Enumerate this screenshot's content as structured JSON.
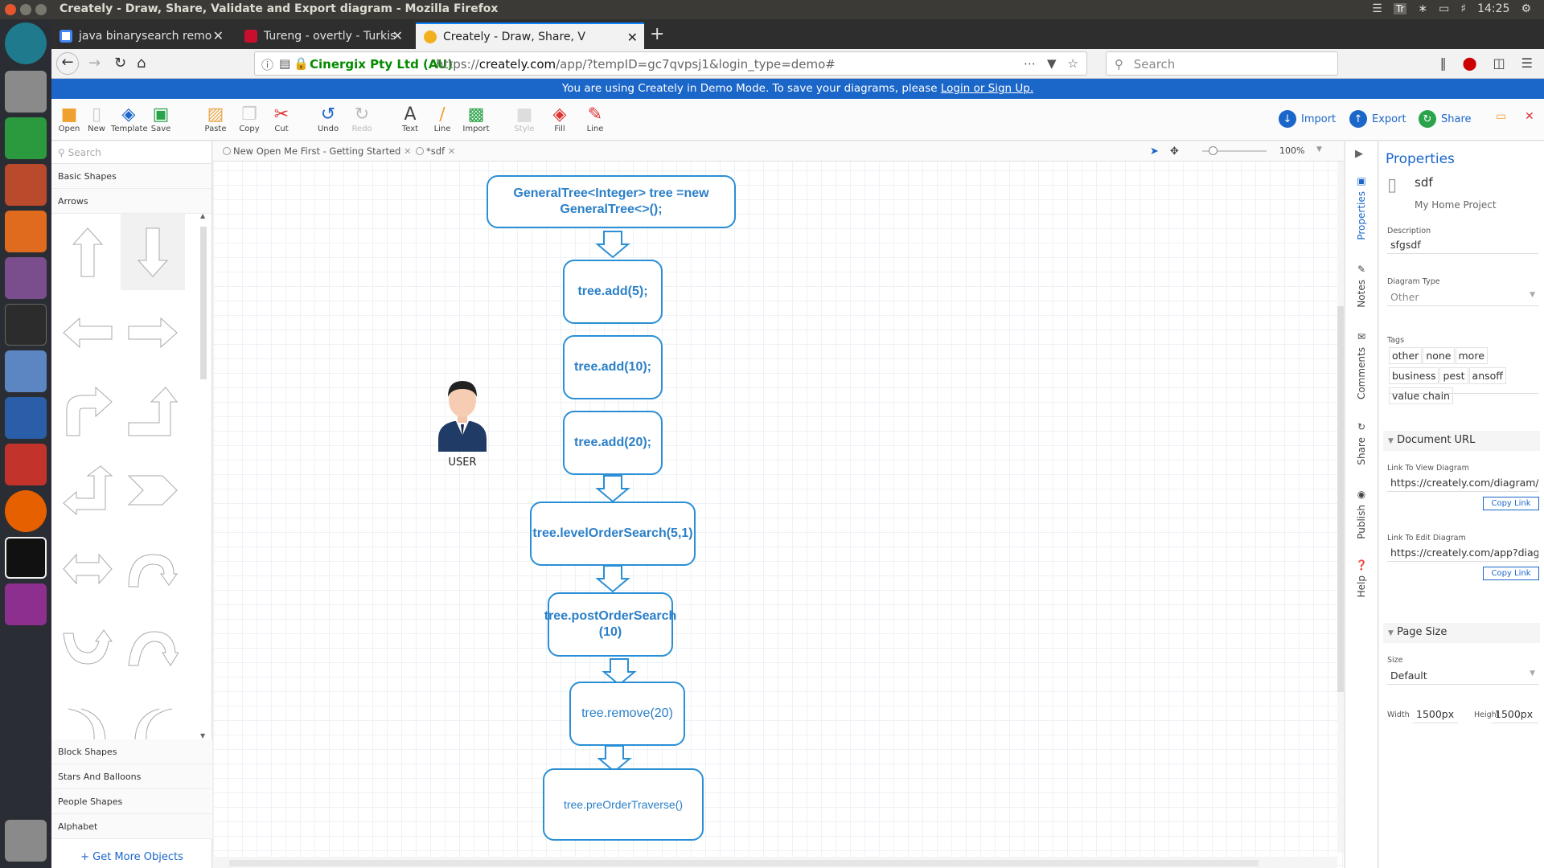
{
  "window": {
    "title": "Creately - Draw, Share, Validate and Export diagram - Mozilla Firefox",
    "keyboard": "Tr",
    "time": "14:25"
  },
  "tabs": [
    {
      "label": "java binarysearch remo",
      "active": false
    },
    {
      "label": "Tureng - overtly - Turkis",
      "active": false
    },
    {
      "label": "Creately - Draw, Share, V",
      "active": true
    }
  ],
  "nav": {
    "org": "Cinergix Pty Ltd (AU)",
    "url_prefix": "https://",
    "url_host": "creately.com",
    "url_path": "/app/?tempID=gc7qvpsj1&login_type=demo#",
    "search_placeholder": "Search"
  },
  "banner": {
    "text": "You are using Creately in Demo Mode. To save your diagrams, please ",
    "link": "Login or Sign Up."
  },
  "toolbar": {
    "open": "Open",
    "new": "New",
    "template": "Template",
    "save": "Save",
    "paste": "Paste",
    "copy": "Copy",
    "cut": "Cut",
    "undo": "Undo",
    "redo": "Redo",
    "text": "Text",
    "line": "Line",
    "import": "Import",
    "style": "Style",
    "fill": "Fill",
    "line2": "Line",
    "import_btn": "Import",
    "export_btn": "Export",
    "share_btn": "Share"
  },
  "library": {
    "search_placeholder": "Search",
    "categories_top": [
      "Basic Shapes",
      "Arrows"
    ],
    "categories_bottom": [
      "Block Shapes",
      "Stars And Balloons",
      "People Shapes",
      "Alphabet"
    ],
    "get_more": "+ Get More Objects"
  },
  "doc_tabs": [
    {
      "label": "New Open Me First - Getting Started"
    },
    {
      "label": "*sdf"
    }
  ],
  "zoom": "100%",
  "diagram": {
    "nodes": [
      "GeneralTree<Integer> tree =new GeneralTree<>();",
      "tree.add(5);",
      "tree.add(10);",
      "tree.add(20);",
      "tree.levelOrderSearch(5,1)",
      "tree.postOrderSearch (10)",
      "tree.remove(20)",
      "tree.preOrderTraverse()"
    ],
    "user_label": "USER"
  },
  "side_tabs": [
    "Properties",
    "Notes",
    "Comments",
    "Share",
    "Publish",
    "Help"
  ],
  "properties": {
    "title": "Properties",
    "doc_name": "sdf",
    "project": "My Home Project",
    "description_label": "Description",
    "description": "sfgsdf",
    "diagram_type_label": "Diagram Type",
    "diagram_type": "Other",
    "tags_label": "Tags",
    "tags": [
      "other",
      "none",
      "more",
      "business",
      "pest",
      "ansoff",
      "value chain"
    ],
    "doc_url_section": "Document URL",
    "view_label": "Link To View Diagram",
    "view_url": "https://creately.com/diagram/jt",
    "edit_label": "Link To Edit Diagram",
    "edit_url": "https://creately.com/app?diagid",
    "copy_link": "Copy Link",
    "page_size_section": "Page Size",
    "size_label": "Size",
    "size": "Default",
    "width_label": "Width",
    "width": "1500px",
    "height_label": "Height",
    "height": "1500px"
  }
}
